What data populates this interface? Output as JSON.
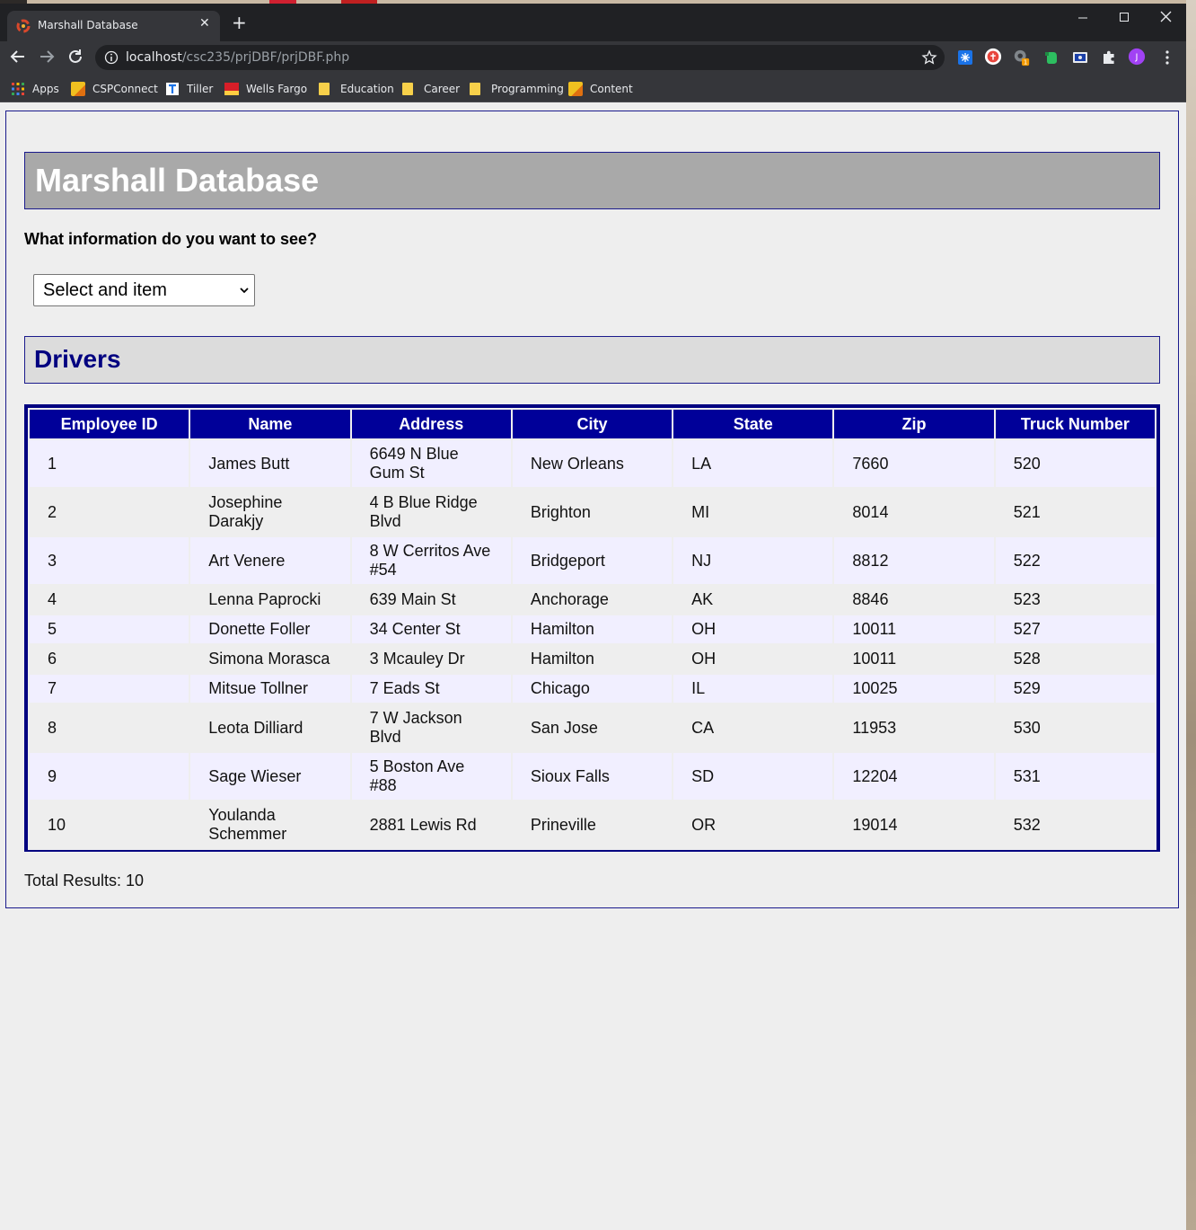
{
  "browser": {
    "tab_title": "Marshall Database",
    "new_tab_label": "+",
    "url_host": "localhost",
    "url_path": "/csc235/prjDBF/prjDBF.php",
    "bookmarks": [
      "Apps",
      "CSPConnect",
      "Tiller",
      "Wells Fargo",
      "Education",
      "Career",
      "Programming",
      "Content"
    ],
    "profile_initial": "J"
  },
  "page": {
    "title": "Marshall Database",
    "question": "What information do you want to see?",
    "select_value": "Select and item",
    "section_title": "Drivers",
    "total_label": "Total Results: 10"
  },
  "table": {
    "headers": [
      "Employee ID",
      "Name",
      "Address",
      "City",
      "State",
      "Zip",
      "Truck Number"
    ],
    "rows": [
      [
        "1",
        "James Butt",
        "6649 N Blue Gum St",
        "New Orleans",
        "LA",
        "7660",
        "520"
      ],
      [
        "2",
        "Josephine Darakjy",
        "4 B Blue Ridge Blvd",
        "Brighton",
        "MI",
        "8014",
        "521"
      ],
      [
        "3",
        "Art Venere",
        "8 W Cerritos Ave #54",
        "Bridgeport",
        "NJ",
        "8812",
        "522"
      ],
      [
        "4",
        "Lenna Paprocki",
        "639 Main St",
        "Anchorage",
        "AK",
        "8846",
        "523"
      ],
      [
        "5",
        "Donette Foller",
        "34 Center St",
        "Hamilton",
        "OH",
        "10011",
        "527"
      ],
      [
        "6",
        "Simona Morasca",
        "3 Mcauley Dr",
        "Hamilton",
        "OH",
        "10011",
        "528"
      ],
      [
        "7",
        "Mitsue Tollner",
        "7 Eads St",
        "Chicago",
        "IL",
        "10025",
        "529"
      ],
      [
        "8",
        "Leota Dilliard",
        "7 W Jackson Blvd",
        "San Jose",
        "CA",
        "11953",
        "530"
      ],
      [
        "9",
        "Sage Wieser",
        "5 Boston Ave #88",
        "Sioux Falls",
        "SD",
        "12204",
        "531"
      ],
      [
        "10",
        "Youlanda Schemmer",
        "2881 Lewis Rd",
        "Prineville",
        "OR",
        "19014",
        "532"
      ]
    ]
  },
  "colors": {
    "header_bg": "#a9a9a9",
    "table_border": "#000080",
    "section_title": "#000080"
  }
}
